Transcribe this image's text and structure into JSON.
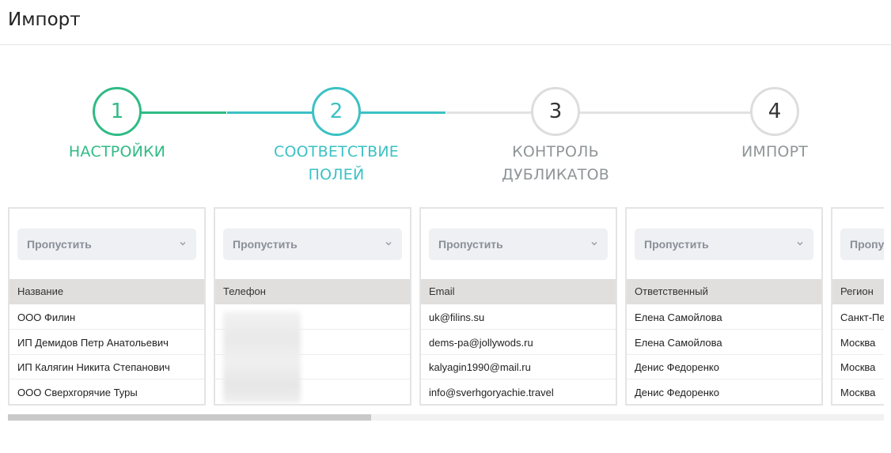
{
  "header": {
    "title": "Импорт"
  },
  "colors": {
    "done": "#2fbb85",
    "active": "#3cc1c4",
    "inactive": "#dcdcdc",
    "inactive_text": "#8f9597"
  },
  "steps": [
    {
      "number": "1",
      "label": "НАСТРОЙКИ",
      "state": "done"
    },
    {
      "number": "2",
      "label": "СООТВЕТСТВИЕ ПОЛЕЙ",
      "state": "active"
    },
    {
      "number": "3",
      "label": "КОНТРОЛЬ ДУБЛИКАТОВ",
      "state": "inactive"
    },
    {
      "number": "4",
      "label": "ИМПОРТ",
      "state": "inactive"
    }
  ],
  "columns": [
    {
      "select": "Пропустить",
      "header": "Название",
      "rows": [
        "ООО Филин",
        "ИП Демидов Петр Анатольевич",
        "ИП Калягин Никита Степанович",
        "ООО Сверхгорячие Туры"
      ],
      "blurred": false
    },
    {
      "select": "Пропустить",
      "header": "Телефон",
      "rows": [
        "",
        "",
        "",
        ""
      ],
      "blurred": true
    },
    {
      "select": "Пропустить",
      "header": "Email",
      "rows": [
        "uk@filins.su",
        "dems-pa@jollywods.ru",
        "kalyagin1990@mail.ru",
        "info@sverhgoryachie.travel"
      ],
      "blurred": false
    },
    {
      "select": "Пропустить",
      "header": "Ответственный",
      "rows": [
        "Елена Самойлова",
        "Елена Самойлова",
        "Денис Федоренко",
        "Денис Федоренко"
      ],
      "blurred": false
    },
    {
      "select": "Пропустить",
      "header": "Регион",
      "rows": [
        "Санкт-Петербург",
        "Москва",
        "Москва",
        "Москва"
      ],
      "blurred": false
    }
  ]
}
